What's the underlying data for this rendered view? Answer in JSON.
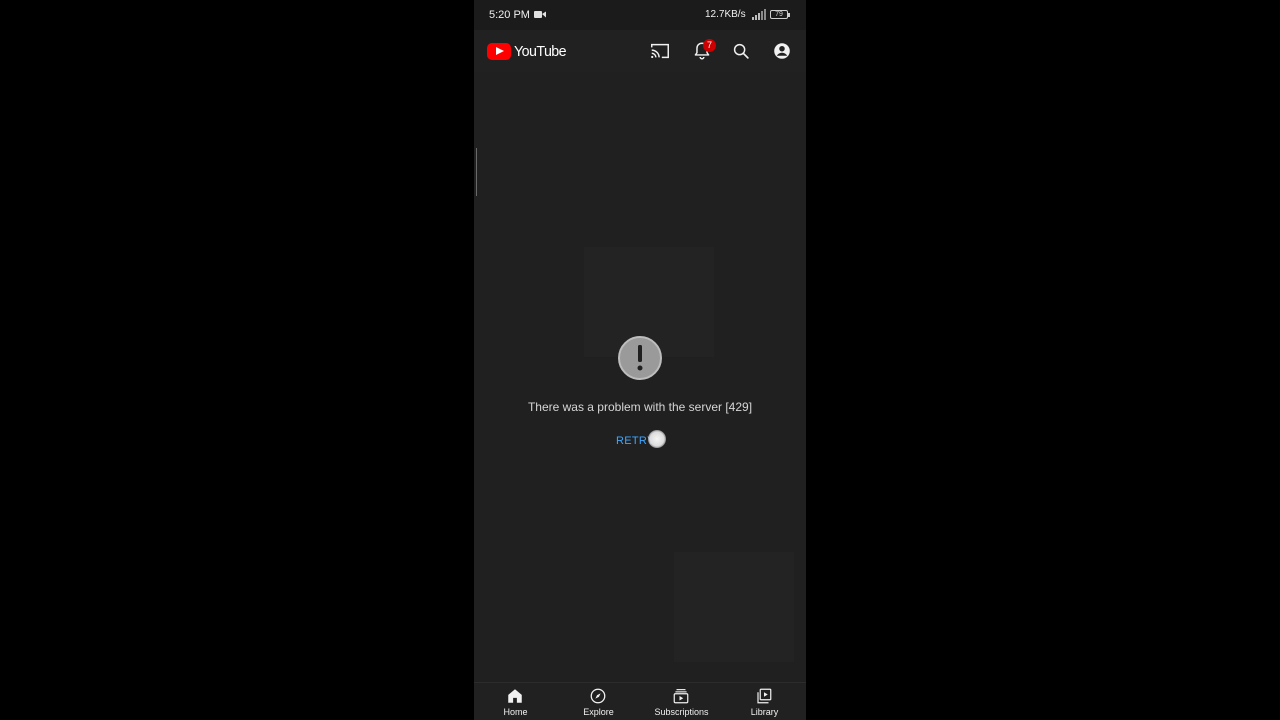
{
  "status_bar": {
    "time": "5:20 PM",
    "network_speed": "12.7KB/s",
    "battery": "79"
  },
  "app_bar": {
    "logo_text": "YouTube",
    "notification_count": "7",
    "icons": [
      "cast-icon",
      "bell-icon",
      "search-icon",
      "account-icon"
    ]
  },
  "error": {
    "message": "There was a problem with the server [429]",
    "retry_label": "RETRY",
    "icon": "error-icon"
  },
  "bottom_nav": {
    "items": [
      {
        "label": "Home",
        "icon": "home-icon",
        "active": true
      },
      {
        "label": "Explore",
        "icon": "explore-icon",
        "active": false
      },
      {
        "label": "Subscriptions",
        "icon": "subscriptions-icon",
        "active": false
      },
      {
        "label": "Library",
        "icon": "library-icon",
        "active": false
      }
    ]
  },
  "colors": {
    "background": "#202020",
    "accent_red": "#ff0000",
    "retry_blue": "#3ea6ff",
    "text": "#f1f1f1"
  }
}
